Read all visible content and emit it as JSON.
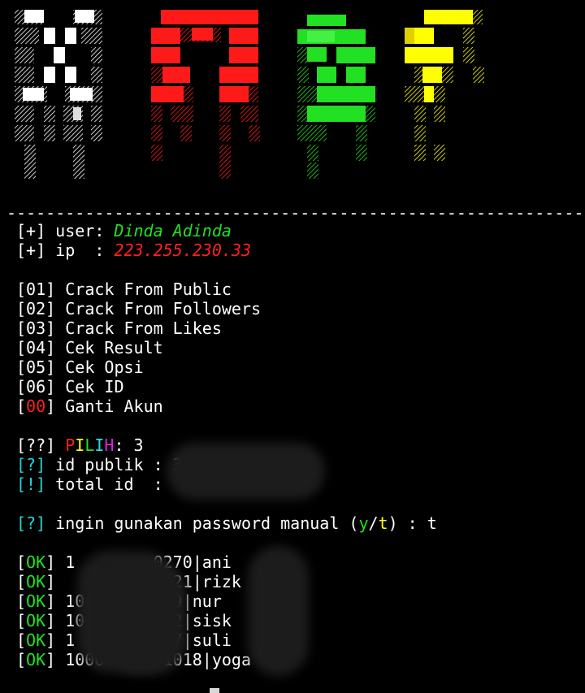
{
  "banner": {
    "letters": [
      {
        "name": "letter-m-white",
        "color": "#ffffff"
      },
      {
        "name": "letter-m-red",
        "color": "#ff1a1a"
      },
      {
        "name": "letter-b-green",
        "color": "#22e022"
      },
      {
        "name": "letter-f-yellow",
        "color": "#ffff00"
      }
    ]
  },
  "separator": "-------------------------------------------------------------",
  "info": {
    "user_prefix": "[+] user: ",
    "user_value": "Dinda Adinda",
    "ip_prefix": "[+] ip  : ",
    "ip_value": "223.255.230.33"
  },
  "menu": [
    {
      "num": "01",
      "label": "Crack From Public"
    },
    {
      "num": "02",
      "label": "Crack From Followers"
    },
    {
      "num": "03",
      "label": "Crack From Likes"
    },
    {
      "num": "04",
      "label": "Cek Result"
    },
    {
      "num": "05",
      "label": "Cek Opsi"
    },
    {
      "num": "06",
      "label": "Cek ID"
    },
    {
      "num": "00",
      "label": "Ganti Akun"
    }
  ],
  "prompt": {
    "tag": "[??]",
    "pilih_letters": [
      "P",
      "I",
      "L",
      "I",
      "H"
    ],
    "pilih_colors": [
      "#ff2020",
      "#ffff00",
      "#22e022",
      "#22e0e0",
      "#e020e0"
    ],
    "after": ": 3",
    "id_publik_tag": "[?]",
    "id_publik_label": " id publik : ",
    "id_publik_value": "31",
    "total_tag": "[!]",
    "total_label": " total id  :",
    "password_tag": "[?]",
    "password_text": " ingin gunakan password manual (",
    "password_y": "y",
    "password_slash": "/",
    "password_t": "t",
    "password_end": ") : t"
  },
  "results": [
    {
      "tag": "OK",
      "text": " 1        0270|ani"
    },
    {
      "tag": "OK",
      "text": "          2921|rizk"
    },
    {
      "tag": "OK",
      "text": " 10       449|nur"
    },
    {
      "tag": "OK",
      "text": " 10       462|sisk"
    },
    {
      "tag": "OK",
      "text": " 1        417|suli"
    },
    {
      "tag": "OK",
      "text": " 1000      1018|yoga"
    }
  ],
  "colors": {
    "ok_green": "#22e022",
    "cyan": "#22d8d8",
    "red": "#ff2020",
    "yellow": "#ffff00"
  }
}
